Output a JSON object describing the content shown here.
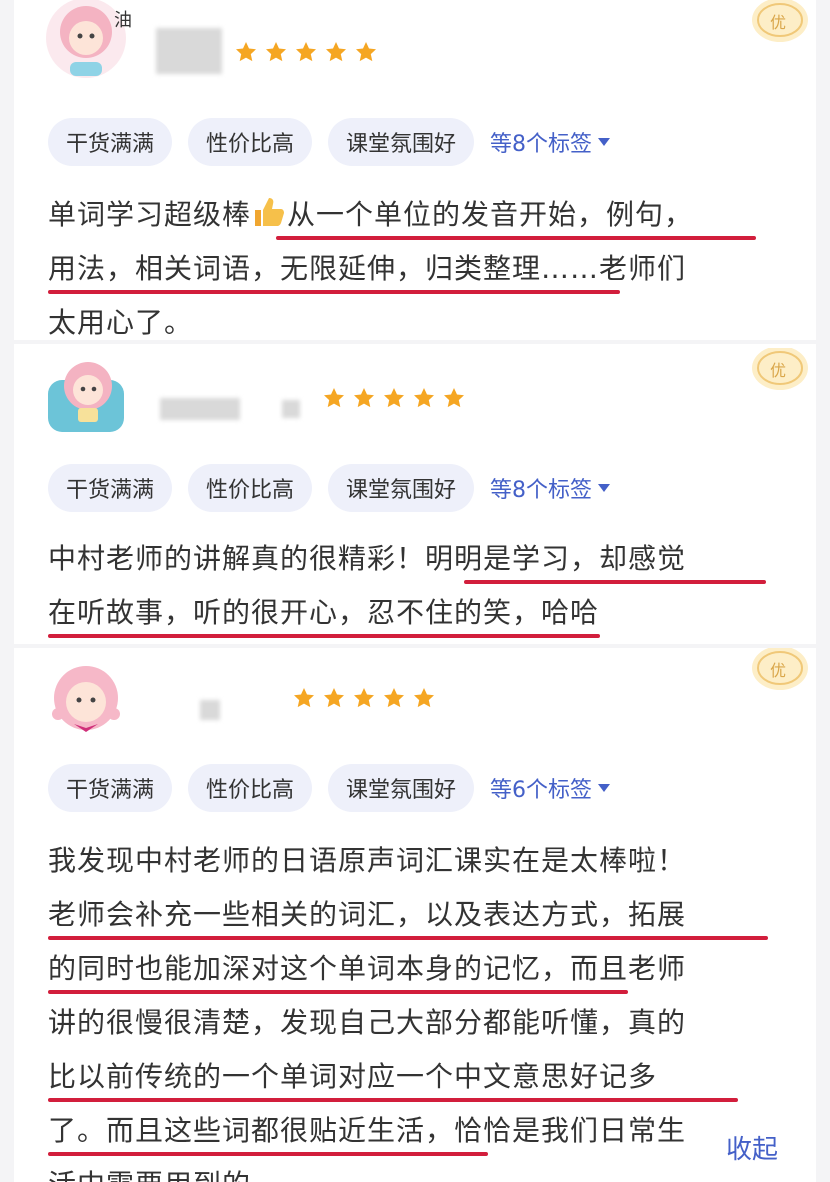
{
  "reviews": [
    {
      "rating": 5,
      "tags": [
        "干货满满",
        "性价比高",
        "课堂氛围好"
      ],
      "more_tags": "等8个标签",
      "lines": [
        "单词学习超级棒",
        "从一个单位的发音开始，例句，",
        "用法，相关词语，无限延伸，归类整理……老师们",
        "太用心了。"
      ]
    },
    {
      "rating": 5,
      "tags": [
        "干货满满",
        "性价比高",
        "课堂氛围好"
      ],
      "more_tags": "等8个标签",
      "lines": [
        "中村老师的讲解真的很精彩！明明是学习，却感觉",
        "在听故事，听的很开心，忍不住的笑，哈哈"
      ]
    },
    {
      "rating": 5,
      "tags": [
        "干货满满",
        "性价比高",
        "课堂氛围好"
      ],
      "more_tags": "等6个标签",
      "lines": [
        "我发现中村老师的日语原声词汇课实在是太棒啦！",
        "老师会补充一些相关的词汇，以及表达方式，拓展",
        "的同时也能加深对这个单词本身的记忆，而且老师",
        "讲的很慢很清楚，发现自己大部分都能听懂，真的",
        "比以前传统的一个单词对应一个中文意思好记多",
        "了。而且这些词都很贴近生活，恰恰是我们日常生",
        "活中需要用到的"
      ],
      "collapse_label": "收起"
    }
  ],
  "avatar_text": "油",
  "badge_text": "优",
  "colors": {
    "underline": "#d21e3c",
    "link": "#4460c8",
    "star": "#f5a623",
    "tag_bg": "#eef0fa"
  },
  "icons": [
    "sheep-avatar-icon",
    "star-icon",
    "thumbs-up-icon",
    "excellent-badge-icon",
    "caret-down-icon"
  ]
}
